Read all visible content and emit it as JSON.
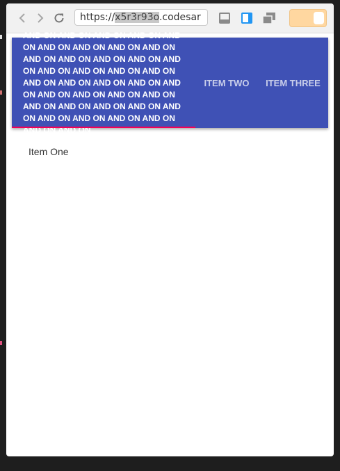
{
  "browser": {
    "url_highlight": "x5r3r93o",
    "url_prefix": "https://",
    "url_suffix": ".codesar"
  },
  "tabs": [
    {
      "label": "And on and on and on and on and on and on and on and on and on and on and on and on and on and on and on and on and on and on and on and on and on and on and on and on and on and on and on and on and on and on and on and on and on and on and on and on and on and on",
      "selected": true
    },
    {
      "label": "Item Two",
      "selected": false
    },
    {
      "label": "Item Three",
      "selected": false
    }
  ],
  "panel": {
    "text": "Item One"
  },
  "colors": {
    "appbar": "#3f51b5",
    "indicator": "#f50057",
    "toggle": "#ffd7a0"
  }
}
